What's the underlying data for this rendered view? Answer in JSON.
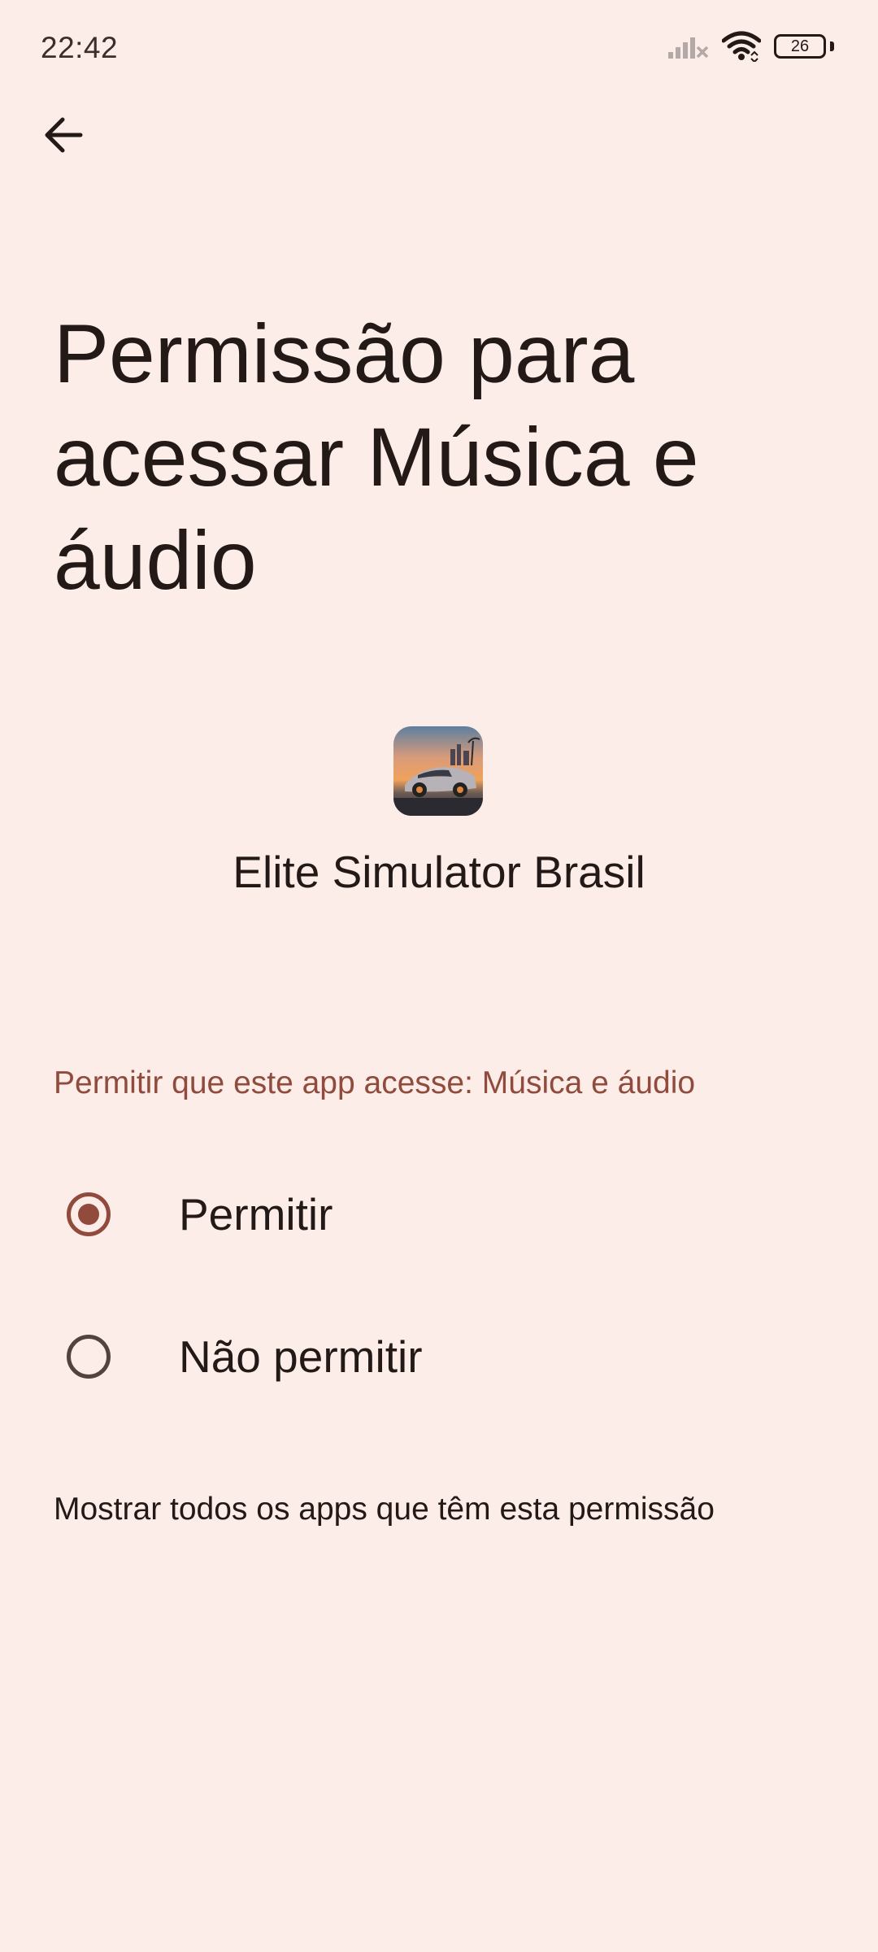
{
  "status_bar": {
    "time": "22:42",
    "battery_level": "26",
    "icons": [
      "signal-icon",
      "wifi-icon",
      "battery-icon"
    ]
  },
  "nav": {
    "back_icon": "arrow-left-icon"
  },
  "page": {
    "title": "Permissão para acessar Música e áudio"
  },
  "app": {
    "name": "Elite Simulator Brasil",
    "icon": "app-icon"
  },
  "permission": {
    "section_label": "Permitir que este app acesse: Música e áudio",
    "options": [
      {
        "label": "Permitir",
        "selected": true
      },
      {
        "label": "Não permitir",
        "selected": false
      }
    ]
  },
  "footer": {
    "show_all_link": "Mostrar todos os apps que têm esta permissão"
  },
  "colors": {
    "background": "#fcede9",
    "accent": "#904b3c",
    "text": "#231917"
  }
}
